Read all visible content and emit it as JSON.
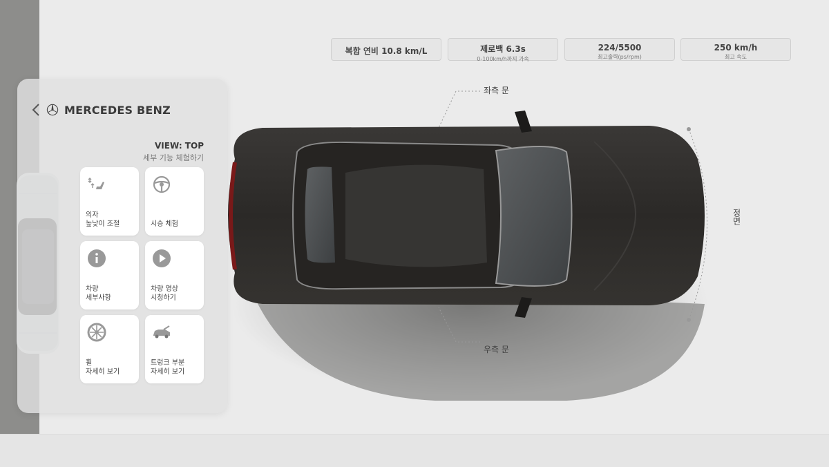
{
  "brand": "MERCEDES BENZ",
  "view": {
    "label": "VIEW: TOP",
    "subtitle": "세부 기능 체험하기"
  },
  "tiles": [
    {
      "label": "의자\n높낮이 조절",
      "icon": "seat-adjust-icon"
    },
    {
      "label": "시승 체험",
      "icon": "steering-wheel-icon"
    },
    {
      "label": "차량\n세부사항",
      "icon": "info-icon"
    },
    {
      "label": "차량 영상\n시청하기",
      "icon": "play-icon"
    },
    {
      "label": "휠\n자세히 보기",
      "icon": "wheel-icon"
    },
    {
      "label": "트렁크 부분\n자세히 보기",
      "icon": "car-trunk-icon"
    }
  ],
  "specs": [
    {
      "main": "복합 연비 10.8 km/L",
      "sub": ""
    },
    {
      "main": "제로백 6.3s",
      "sub": "0-100km/h까지 가속"
    },
    {
      "main": "224/5500",
      "sub": "최고출력(ps/rpm)"
    },
    {
      "main": "250 km/h",
      "sub": "최고 속도"
    }
  ],
  "annotations": {
    "left_door": "좌측 문",
    "right_door": "우측 문",
    "front": "정면"
  },
  "colors": {
    "panel": "#e0e0e0",
    "tile": "#ffffff",
    "car_body": "#2f2d2b",
    "background": "#ebebeb"
  }
}
